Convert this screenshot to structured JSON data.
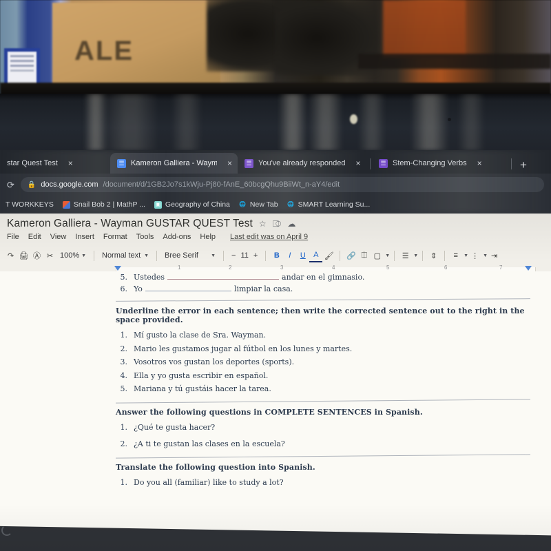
{
  "scene": {
    "description": "photo-of-laptop-screen",
    "background_object_text": "ALE"
  },
  "browser": {
    "tabs": [
      {
        "title": "star Quest Test",
        "favicon": "docs-icon",
        "active": false,
        "close": "×"
      },
      {
        "title": "Kameron Galliera - Wayman GU",
        "favicon": "docs-icon",
        "active": true,
        "close": "×"
      },
      {
        "title": "You've already responded",
        "favicon": "forms-icon",
        "active": false,
        "close": "×"
      },
      {
        "title": "Stem-Changing Verbs",
        "favicon": "forms-icon",
        "active": false,
        "close": "×"
      }
    ],
    "new_tab_label": "+",
    "reload_icon": "⟳",
    "lock_icon": "🔒",
    "url_host": "docs.google.com",
    "url_path": "/document/d/1GB2Jo7s1kWju-Pj80-fAnE_60bcgQhu9BiiWt_n-aY4/edit",
    "bookmarks": [
      {
        "label": "T WORKKEYS",
        "icon": "none"
      },
      {
        "label": "Snail Bob 2 | MathP ...",
        "icon": "snail-icon"
      },
      {
        "label": "Geography of China",
        "icon": "image-icon"
      },
      {
        "label": "New Tab",
        "icon": "globe-icon"
      },
      {
        "label": "SMART Learning Su...",
        "icon": "globe-icon"
      }
    ]
  },
  "docs": {
    "title": "Kameron Galliera - Wayman GUSTAR QUEST Test",
    "title_icons": [
      "star-icon",
      "move-to-folder-icon",
      "cloud-status-icon"
    ],
    "menus": [
      "File",
      "Edit",
      "View",
      "Insert",
      "Format",
      "Tools",
      "Add-ons",
      "Help"
    ],
    "last_edit": "Last edit was on April 9",
    "toolbar": {
      "undo_icon": "undo-icon",
      "print_icon": "print-icon",
      "spellcheck_icon": "spellcheck-icon",
      "paint_format_icon": "paint-format-icon",
      "zoom": "100%",
      "paragraph_style": "Normal text",
      "font": "Bree Serif",
      "font_size_decrease": "−",
      "font_size": "11",
      "font_size_increase": "+",
      "bold": "B",
      "italic": "I",
      "underline": "U",
      "text_color": "A",
      "highlight_icon": "highlight-icon",
      "link_icon": "link-icon",
      "comment_icon": "comment-icon",
      "image_icon": "image-icon",
      "align_icon": "align-icon",
      "line_spacing_icon": "line-spacing-icon",
      "numbered_list_icon": "numbered-list-icon",
      "bulleted_list_icon": "bulleted-list-icon",
      "indent_icon": "indent-icon"
    },
    "ruler": {
      "numbers": [
        "1",
        "2",
        "3",
        "4",
        "5",
        "6",
        "7"
      ]
    }
  },
  "document": {
    "fill_in_items": [
      {
        "num": "5.",
        "before": "Ustedes",
        "blank": "",
        "after": "andar en el gimnasio.",
        "after_underlined_word": "andar"
      },
      {
        "num": "6.",
        "before": "Yo",
        "blank": "",
        "after": "limpiar la casa.",
        "after_underlined_word": ""
      }
    ],
    "sections": [
      {
        "heading": "Underline the error in each sentence; then write the corrected sentence out to the right in the space provided.",
        "items": [
          {
            "num": "1.",
            "text": "Mí gusto la clase de Sra. Wayman."
          },
          {
            "num": "2.",
            "text": "Mario les gustamos jugar al fútbol en los lunes y martes."
          },
          {
            "num": "3.",
            "text": "Vosotros vos gustan los deportes (sports)."
          },
          {
            "num": "4.",
            "text": "Ella y yo gusta escribir en español."
          },
          {
            "num": "5.",
            "text": "Mariana y tú gustáis hacer la tarea."
          }
        ]
      },
      {
        "heading": "Answer the following questions in COMPLETE SENTENCES in Spanish.",
        "items": [
          {
            "num": "1.",
            "text": "¿Qué te gusta hacer?"
          },
          {
            "num": "2.",
            "text": "¿A ti te gustan las clases en la escuela?"
          }
        ]
      },
      {
        "heading": "Translate the following question into Spanish.",
        "items": [
          {
            "num": "1.",
            "text": "Do you all (familiar) like to study a lot?"
          }
        ]
      }
    ]
  },
  "colors": {
    "browser_chrome": "#2b2f36",
    "docs_bg": "#f1efe9",
    "page_bg": "#fbfaf5",
    "doc_text": "#2d3c4f",
    "accent_blue": "#1b63c9",
    "docs_favicon": "#4285f4",
    "forms_favicon": "#7248c9"
  }
}
